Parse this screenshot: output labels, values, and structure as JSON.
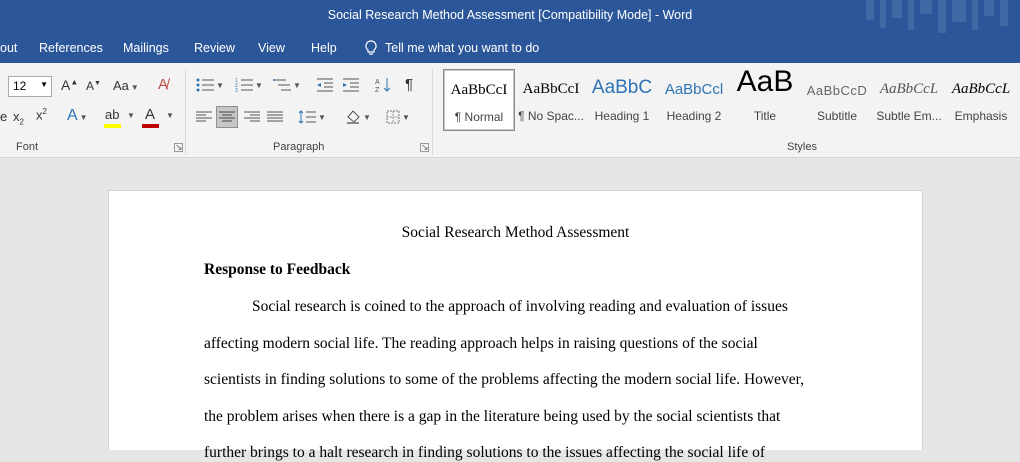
{
  "window": {
    "title": "Social Research Method Assessment [Compatibility Mode]  -  Word"
  },
  "menu": {
    "tabs": [
      "out",
      "References",
      "Mailings",
      "Review",
      "View",
      "Help"
    ],
    "tell_me": "Tell me what you want to do"
  },
  "ribbon": {
    "font": {
      "size": "12",
      "group_label": "Font",
      "case_label": "Aa"
    },
    "paragraph": {
      "group_label": "Paragraph"
    },
    "styles": {
      "group_label": "Styles",
      "items": [
        {
          "preview": "AaBbCcI",
          "label": "¶ Normal"
        },
        {
          "preview": "AaBbCcI",
          "label": "¶ No Spac..."
        },
        {
          "preview": "AaBbC",
          "label": "Heading 1"
        },
        {
          "preview": "AaBbCcl",
          "label": "Heading 2"
        },
        {
          "preview": "AaB",
          "label": "Title"
        },
        {
          "preview": "AaBbCcD",
          "label": "Subtitle"
        },
        {
          "preview": "AaBbCcL",
          "label": "Subtle Em..."
        },
        {
          "preview": "AaBbCcL",
          "label": "Emphasis"
        }
      ]
    }
  },
  "document": {
    "title": "Social Research Method Assessment",
    "heading": "Response to Feedback",
    "lines": [
      "Social research is coined to the approach of involving reading and evaluation of issues",
      "affecting modern social life. The reading approach helps in raising questions of the social",
      "scientists in finding solutions to some of the problems affecting the modern social life. However,",
      "the problem arises when there is a gap in the literature being used by the social scientists that",
      "further brings to a halt research in finding solutions to the issues affecting the social life of"
    ]
  },
  "colors": {
    "accent": "#2b579a",
    "font_color_bar": "#c00000",
    "highlight_bar": "#ffff00"
  }
}
